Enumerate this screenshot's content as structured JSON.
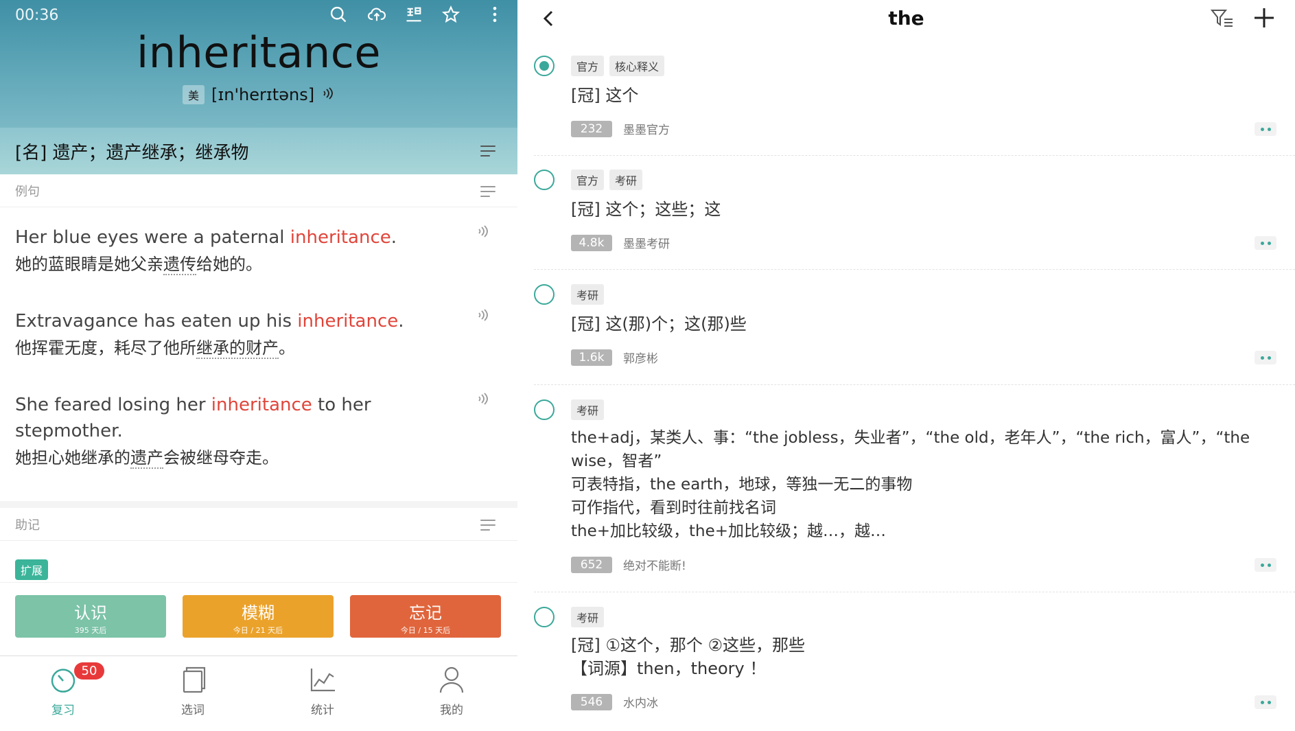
{
  "left": {
    "status_time": "00:36",
    "headword": "inheritance",
    "pronunciation": {
      "region": "美",
      "ipa": "[ɪn'herɪtəns]"
    },
    "meaning": "[名] 遗产；遗产继承；继承物",
    "examples_title": "例句",
    "examples": [
      {
        "en_pre": "Her blue eyes were a paternal ",
        "en_hl": "inheritance",
        "en_post": ".",
        "zh_pre": "她的蓝眼睛是她父亲",
        "zh_ul": "遗传",
        "zh_post": "给她的。"
      },
      {
        "en_pre": "Extravagance has eaten up his ",
        "en_hl": "inheritance",
        "en_post": ".",
        "zh_pre": "他挥霍无度，耗尽了他所",
        "zh_ul": "继承的财产",
        "zh_post": "。"
      },
      {
        "en_pre": "She feared losing her ",
        "en_hl": "inheritance",
        "en_post": " to her stepmother.",
        "zh_pre": "她担心她继承的",
        "zh_ul": "遗产",
        "zh_post": "会被继母夺走。"
      }
    ],
    "mnemonic_title": "助记",
    "expand_tag": "扩展",
    "answers": [
      {
        "label": "认识",
        "sub": "395 天后",
        "color": "#7cc3a8"
      },
      {
        "label": "模糊",
        "sub": "今日 / 21 天后",
        "color": "#eba22b"
      },
      {
        "label": "忘记",
        "sub": "今日 / 15 天后",
        "color": "#e0653c"
      }
    ],
    "tabs": [
      {
        "label": "复习",
        "icon": "review-gauge-icon",
        "active": true
      },
      {
        "label": "选词",
        "icon": "word-book-icon",
        "active": false
      },
      {
        "label": "统计",
        "icon": "stats-chart-icon",
        "active": false
      },
      {
        "label": "我的",
        "icon": "profile-icon",
        "active": false
      }
    ],
    "badge": "50",
    "header_icons": [
      "search-icon",
      "cloud-upload-icon",
      "edit-word-icon",
      "star-icon",
      "more-vertical-icon"
    ]
  },
  "right": {
    "title": "the",
    "definitions": [
      {
        "selected": true,
        "tags": [
          "官方",
          "核心释义"
        ],
        "text": [
          "[冠] 这个"
        ],
        "count": "232",
        "source": "墨墨官方"
      },
      {
        "selected": false,
        "tags": [
          "官方",
          "考研"
        ],
        "text": [
          "[冠] 这个；这些；这"
        ],
        "count": "4.8k",
        "source": "墨墨考研"
      },
      {
        "selected": false,
        "tags": [
          "考研"
        ],
        "text": [
          "[冠] 这(那)个；这(那)些"
        ],
        "count": "1.6k",
        "source": "郭彦彬"
      },
      {
        "selected": false,
        "tags": [
          "考研"
        ],
        "text": [
          "the+adj，某类人、事：“the jobless，失业者”，“the old，老年人”，“the rich，富人”，“the wise，智者”",
          "可表特指，the earth，地球，等独一无二的事物",
          "可作指代，看到时往前找名词",
          "the+加比较级，the+加比较级；越…，越…"
        ],
        "count": "652",
        "source": "绝对不能断!"
      },
      {
        "selected": false,
        "tags": [
          "考研"
        ],
        "text": [
          "[冠] ①这个，那个 ②这些，那些",
          "【词源】then，theory ！"
        ],
        "count": "546",
        "source": "水内冰"
      }
    ]
  }
}
